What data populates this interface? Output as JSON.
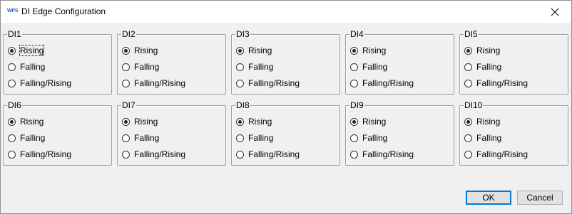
{
  "window": {
    "title": "DI Edge Configuration",
    "app_icon_text": "WPS"
  },
  "groups": [
    {
      "name": "DI1",
      "options": [
        "Rising",
        "Falling",
        "Falling/Rising"
      ],
      "selected": 0
    },
    {
      "name": "DI2",
      "options": [
        "Rising",
        "Falling",
        "Falling/Rising"
      ],
      "selected": 0
    },
    {
      "name": "DI3",
      "options": [
        "Rising",
        "Falling",
        "Falling/Rising"
      ],
      "selected": 0
    },
    {
      "name": "DI4",
      "options": [
        "Rising",
        "Falling",
        "Falling/Rising"
      ],
      "selected": 0
    },
    {
      "name": "DI5",
      "options": [
        "Rising",
        "Falling",
        "Falling/Rising"
      ],
      "selected": 0
    },
    {
      "name": "DI6",
      "options": [
        "Rising",
        "Falling",
        "Falling/Rising"
      ],
      "selected": 0
    },
    {
      "name": "DI7",
      "options": [
        "Rising",
        "Falling",
        "Falling/Rising"
      ],
      "selected": 0
    },
    {
      "name": "DI8",
      "options": [
        "Rising",
        "Falling",
        "Falling/Rising"
      ],
      "selected": 0
    },
    {
      "name": "DI9",
      "options": [
        "Rising",
        "Falling",
        "Falling/Rising"
      ],
      "selected": 0
    },
    {
      "name": "DI10",
      "options": [
        "Rising",
        "Falling",
        "Falling/Rising"
      ],
      "selected": 0
    }
  ],
  "buttons": {
    "ok": "OK",
    "cancel": "Cancel"
  },
  "colors": {
    "default_button_border": "#0078d7"
  }
}
